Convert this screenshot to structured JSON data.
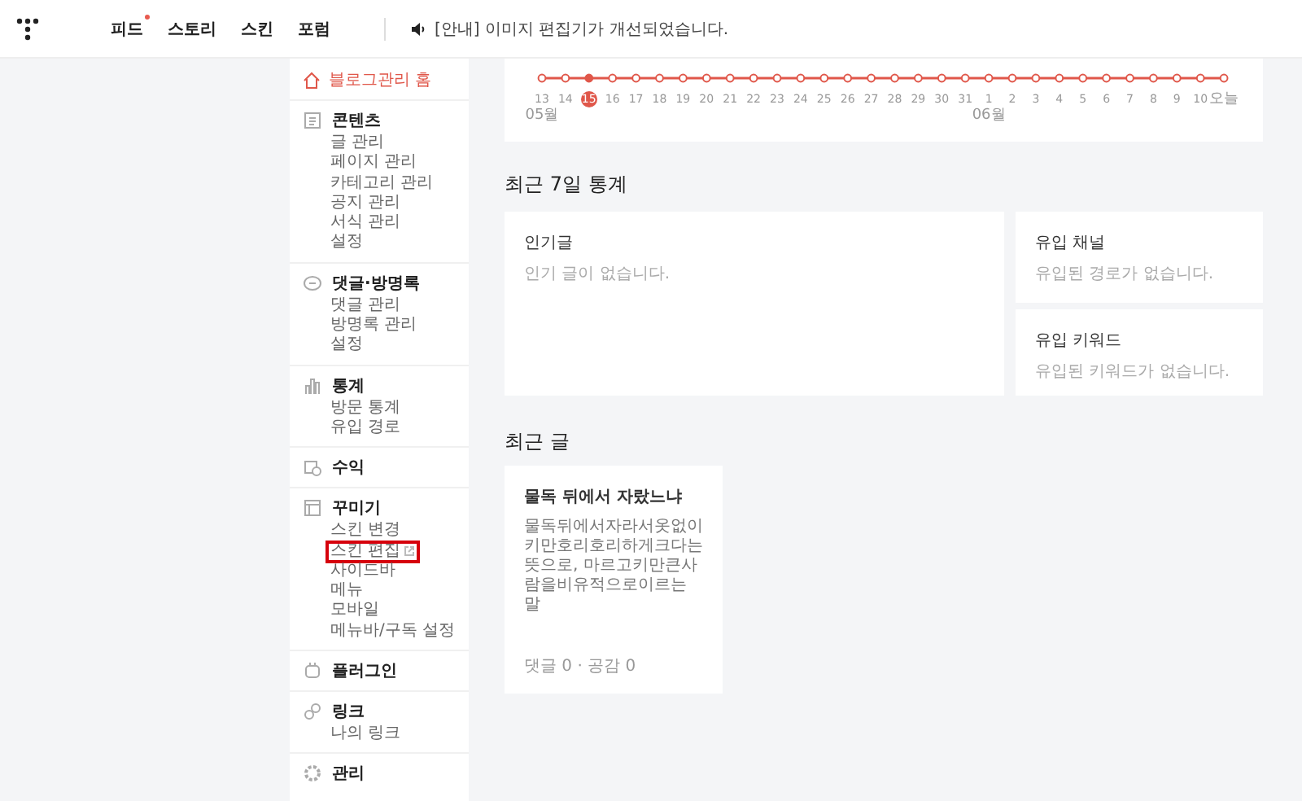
{
  "header": {
    "nav": [
      {
        "label": "피드",
        "new": true
      },
      {
        "label": "스토리",
        "new": false
      },
      {
        "label": "스킨",
        "new": false
      },
      {
        "label": "포럼",
        "new": false
      }
    ],
    "notice": "[안내] 이미지 편집기가 개선되었습니다."
  },
  "sidebar": {
    "home": {
      "label": "블로그관리 홈",
      "selected": true
    },
    "groups": [
      {
        "title": "콘텐츠",
        "items": [
          {
            "label": "글 관리",
            "highlighted": false,
            "external": false
          },
          {
            "label": "페이지 관리",
            "highlighted": false,
            "external": false
          },
          {
            "label": "카테고리 관리",
            "highlighted": false,
            "external": false
          },
          {
            "label": "공지 관리",
            "highlighted": false,
            "external": false
          },
          {
            "label": "서식 관리",
            "highlighted": false,
            "external": false
          },
          {
            "label": "설정",
            "highlighted": false,
            "external": false
          }
        ]
      },
      {
        "title": "댓글·방명록",
        "items": [
          {
            "label": "댓글 관리",
            "highlighted": false,
            "external": false
          },
          {
            "label": "방명록 관리",
            "highlighted": false,
            "external": false
          },
          {
            "label": "설정",
            "highlighted": false,
            "external": false
          }
        ]
      },
      {
        "title": "통계",
        "items": [
          {
            "label": "방문 통계",
            "highlighted": false,
            "external": false
          },
          {
            "label": "유입 경로",
            "highlighted": false,
            "external": false
          }
        ]
      },
      {
        "title": "수익"
      },
      {
        "title": "꾸미기",
        "items": [
          {
            "label": "스킨 변경",
            "highlighted": false,
            "external": false
          },
          {
            "label": "스킨 편집",
            "highlighted": true,
            "external": true
          },
          {
            "label": "사이드바",
            "highlighted": false,
            "external": false
          },
          {
            "label": "메뉴",
            "highlighted": false,
            "external": false
          },
          {
            "label": "모바일",
            "highlighted": false,
            "external": false
          },
          {
            "label": "메뉴바/구독 설정",
            "highlighted": false,
            "external": false
          }
        ]
      },
      {
        "title": "플러그인"
      },
      {
        "title": "링크",
        "items": [
          {
            "label": "나의 링크",
            "highlighted": false,
            "external": false
          }
        ]
      },
      {
        "title": "관리"
      }
    ]
  },
  "visits": {
    "days": [
      {
        "label": "13",
        "month": "05월",
        "selected": false
      },
      {
        "label": "14",
        "selected": false
      },
      {
        "label": "15",
        "selected": true
      },
      {
        "label": "16",
        "selected": false
      },
      {
        "label": "17",
        "selected": false
      },
      {
        "label": "18",
        "selected": false
      },
      {
        "label": "19",
        "selected": false
      },
      {
        "label": "20",
        "selected": false
      },
      {
        "label": "21",
        "selected": false
      },
      {
        "label": "22",
        "selected": false
      },
      {
        "label": "23",
        "selected": false
      },
      {
        "label": "24",
        "selected": false
      },
      {
        "label": "25",
        "selected": false
      },
      {
        "label": "26",
        "selected": false
      },
      {
        "label": "27",
        "selected": false
      },
      {
        "label": "28",
        "selected": false
      },
      {
        "label": "29",
        "selected": false
      },
      {
        "label": "30",
        "selected": false
      },
      {
        "label": "31",
        "selected": false
      },
      {
        "label": "1",
        "month": "06월",
        "selected": false
      },
      {
        "label": "2",
        "selected": false
      },
      {
        "label": "3",
        "selected": false
      },
      {
        "label": "4",
        "selected": false
      },
      {
        "label": "5",
        "selected": false
      },
      {
        "label": "6",
        "selected": false
      },
      {
        "label": "7",
        "selected": false
      },
      {
        "label": "8",
        "selected": false
      },
      {
        "label": "9",
        "selected": false
      },
      {
        "label": "10",
        "selected": false
      },
      {
        "label": "오늘",
        "selected": false
      }
    ]
  },
  "weekly_stats": {
    "title": "최근 7일 통계",
    "cards": [
      {
        "title": "인기글",
        "empty": "인기 글이 없습니다."
      },
      {
        "title": "유입 채널",
        "empty": "유입된 경로가 없습니다."
      },
      {
        "title": "유입 키워드",
        "empty": "유입된 키워드가 없습니다."
      }
    ]
  },
  "recent_posts": {
    "title": "최근 글",
    "posts": [
      {
        "title": "물독 뒤에서 자랐느냐",
        "excerpt": "물독뒤에서자라서옷없이키만호리호리하게크다는뜻으로, 마르고키만큰사람을비유적으로이르는 말",
        "meta": "댓글 0 · 공감 0"
      }
    ]
  }
}
